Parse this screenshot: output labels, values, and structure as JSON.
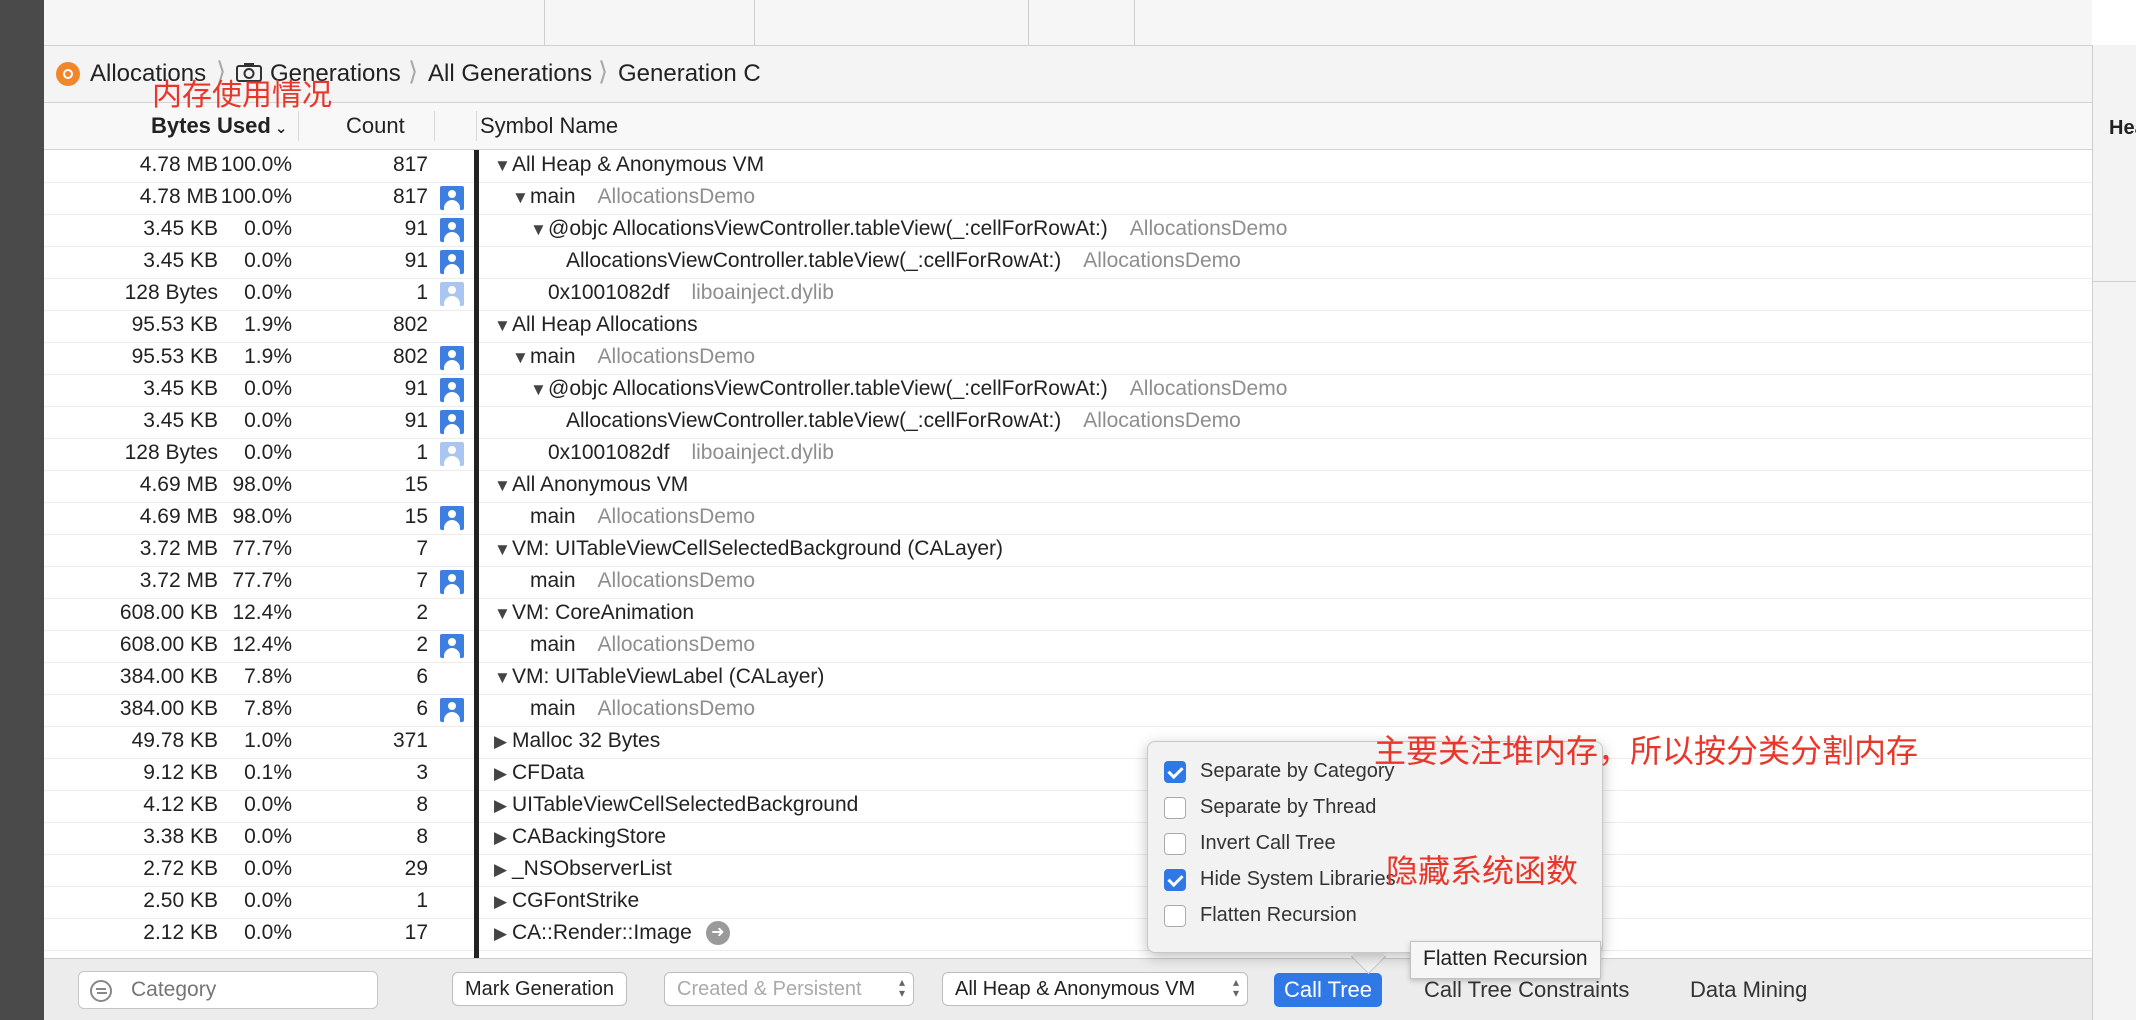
{
  "breadcrumb": [
    "Allocations",
    "Generations",
    "All Generations",
    "Generation C"
  ],
  "columns": {
    "bytes_used": "Bytes Used",
    "count": "Count",
    "symbol_name": "Symbol Name"
  },
  "rows": [
    {
      "bytes": "4.78 MB",
      "pct": "100.0%",
      "count": "817",
      "user": "none",
      "tri": "open",
      "indent": 0,
      "symbol": "All Heap & Anonymous VM",
      "lib": ""
    },
    {
      "bytes": "4.78 MB",
      "pct": "100.0%",
      "count": "817",
      "user": "dark",
      "tri": "open",
      "indent": 1,
      "symbol": "main",
      "lib": "AllocationsDemo"
    },
    {
      "bytes": "3.45 KB",
      "pct": "0.0%",
      "count": "91",
      "user": "dark",
      "tri": "open",
      "indent": 2,
      "symbol": "@objc AllocationsViewController.tableView(_:cellForRowAt:)",
      "lib": "AllocationsDemo"
    },
    {
      "bytes": "3.45 KB",
      "pct": "0.0%",
      "count": "91",
      "user": "dark",
      "tri": "none",
      "indent": 3,
      "symbol": "AllocationsViewController.tableView(_:cellForRowAt:)",
      "lib": "AllocationsDemo"
    },
    {
      "bytes": "128 Bytes",
      "pct": "0.0%",
      "count": "1",
      "user": "light",
      "tri": "none",
      "indent": 2,
      "symbol": "0x1001082df",
      "lib": "liboainject.dylib"
    },
    {
      "bytes": "95.53 KB",
      "pct": "1.9%",
      "count": "802",
      "user": "none",
      "tri": "open",
      "indent": 0,
      "symbol": "All Heap Allocations",
      "lib": ""
    },
    {
      "bytes": "95.53 KB",
      "pct": "1.9%",
      "count": "802",
      "user": "dark",
      "tri": "open",
      "indent": 1,
      "symbol": "main",
      "lib": "AllocationsDemo"
    },
    {
      "bytes": "3.45 KB",
      "pct": "0.0%",
      "count": "91",
      "user": "dark",
      "tri": "open",
      "indent": 2,
      "symbol": "@objc AllocationsViewController.tableView(_:cellForRowAt:)",
      "lib": "AllocationsDemo"
    },
    {
      "bytes": "3.45 KB",
      "pct": "0.0%",
      "count": "91",
      "user": "dark",
      "tri": "none",
      "indent": 3,
      "symbol": "AllocationsViewController.tableView(_:cellForRowAt:)",
      "lib": "AllocationsDemo"
    },
    {
      "bytes": "128 Bytes",
      "pct": "0.0%",
      "count": "1",
      "user": "light",
      "tri": "none",
      "indent": 2,
      "symbol": "0x1001082df",
      "lib": "liboainject.dylib"
    },
    {
      "bytes": "4.69 MB",
      "pct": "98.0%",
      "count": "15",
      "user": "none",
      "tri": "open",
      "indent": 0,
      "symbol": "All Anonymous VM",
      "lib": ""
    },
    {
      "bytes": "4.69 MB",
      "pct": "98.0%",
      "count": "15",
      "user": "dark",
      "tri": "none",
      "indent": 1,
      "symbol": "main",
      "lib": "AllocationsDemo"
    },
    {
      "bytes": "3.72 MB",
      "pct": "77.7%",
      "count": "7",
      "user": "none",
      "tri": "open",
      "indent": 0,
      "symbol": "VM: UITableViewCellSelectedBackground (CALayer)",
      "lib": ""
    },
    {
      "bytes": "3.72 MB",
      "pct": "77.7%",
      "count": "7",
      "user": "dark",
      "tri": "none",
      "indent": 1,
      "symbol": "main",
      "lib": "AllocationsDemo"
    },
    {
      "bytes": "608.00 KB",
      "pct": "12.4%",
      "count": "2",
      "user": "none",
      "tri": "open",
      "indent": 0,
      "symbol": "VM: CoreAnimation",
      "lib": ""
    },
    {
      "bytes": "608.00 KB",
      "pct": "12.4%",
      "count": "2",
      "user": "dark",
      "tri": "none",
      "indent": 1,
      "symbol": "main",
      "lib": "AllocationsDemo"
    },
    {
      "bytes": "384.00 KB",
      "pct": "7.8%",
      "count": "6",
      "user": "none",
      "tri": "open",
      "indent": 0,
      "symbol": "VM: UITableViewLabel (CALayer)",
      "lib": ""
    },
    {
      "bytes": "384.00 KB",
      "pct": "7.8%",
      "count": "6",
      "user": "dark",
      "tri": "none",
      "indent": 1,
      "symbol": "main",
      "lib": "AllocationsDemo"
    },
    {
      "bytes": "49.78 KB",
      "pct": "1.0%",
      "count": "371",
      "user": "none",
      "tri": "closed",
      "indent": 0,
      "symbol": "Malloc 32 Bytes",
      "lib": ""
    },
    {
      "bytes": "9.12 KB",
      "pct": "0.1%",
      "count": "3",
      "user": "none",
      "tri": "closed",
      "indent": 0,
      "symbol": "CFData",
      "lib": ""
    },
    {
      "bytes": "4.12 KB",
      "pct": "0.0%",
      "count": "8",
      "user": "none",
      "tri": "closed",
      "indent": 0,
      "symbol": "UITableViewCellSelectedBackground",
      "lib": ""
    },
    {
      "bytes": "3.38 KB",
      "pct": "0.0%",
      "count": "8",
      "user": "none",
      "tri": "closed",
      "indent": 0,
      "symbol": "CABackingStore",
      "lib": ""
    },
    {
      "bytes": "2.72 KB",
      "pct": "0.0%",
      "count": "29",
      "user": "none",
      "tri": "closed",
      "indent": 0,
      "symbol": "_NSObserverList",
      "lib": ""
    },
    {
      "bytes": "2.50 KB",
      "pct": "0.0%",
      "count": "1",
      "user": "none",
      "tri": "closed",
      "indent": 0,
      "symbol": "CGFontStrike",
      "lib": ""
    },
    {
      "bytes": "2.12 KB",
      "pct": "0.0%",
      "count": "17",
      "user": "none",
      "tri": "closed",
      "indent": 0,
      "symbol": "CA::Render::Image",
      "lib": "",
      "arrow": true
    }
  ],
  "popover": [
    {
      "label": "Separate by Category",
      "checked": true
    },
    {
      "label": "Separate by Thread",
      "checked": false
    },
    {
      "label": "Invert Call Tree",
      "checked": false
    },
    {
      "label": "Hide System Libraries",
      "checked": true
    },
    {
      "label": "Flatten Recursion",
      "checked": false
    }
  ],
  "tooltip": "Flatten Recursion",
  "bottom_bar": {
    "category_placeholder": "Category",
    "mark_generation": "Mark Generation",
    "created_persistent": "Created & Persistent",
    "heap_select": "All Heap & Anonymous VM",
    "tabs": [
      "Call Tree",
      "Call Tree Constraints",
      "Data Mining"
    ]
  },
  "right_panel_title": "Hea",
  "annotations": {
    "memory_usage": "内存使用情况",
    "focus_heap": "主要关注堆内存，所以按分类分割内存",
    "hide_system": "隐藏系统函数"
  },
  "colors": {
    "accent": "#2f78e6",
    "annotation": "#e8372a",
    "alloc_icon": "#f0882b"
  }
}
